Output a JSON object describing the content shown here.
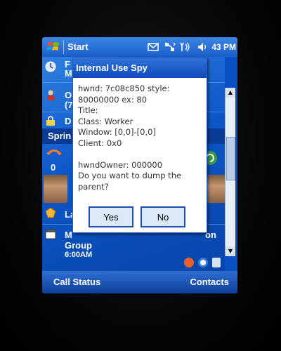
{
  "titlebar": {
    "app_label": "Start",
    "time": "43 PM",
    "icons": [
      "windows-flag-icon",
      "messaging-icon",
      "connectivity-icon",
      "signal-icon",
      "speaker-icon"
    ]
  },
  "today": {
    "partial_labels": {
      "date_row": "F\nM",
      "owner_row": "O\n(7",
      "lock_row": "D",
      "carrier_row": "Sprin",
      "missed_count": "0",
      "la_row": "La",
      "calendar_row_1": "M",
      "calendar_row_1_suffix": "on",
      "calendar_row_2": "Group",
      "calendar_time": "6:00AM"
    }
  },
  "dialog": {
    "title": "Internal Use Spy",
    "body": "hwnd: 7c08c850 style:\n80000000 ex: 80\nTitle:\nClass: Worker\nWindow: [0,0]-[0,0]\nClient: 0x0\n\nhwndOwner: 000000\nDo you want to dump the\nparent?",
    "yes_label": "Yes",
    "no_label": "No"
  },
  "softkeys": {
    "left": "Call Status",
    "right": "Contacts"
  },
  "colors": {
    "accent": "#1b5ec9",
    "today_background": "#0d56c8",
    "dialog_button": "#dbe9f8"
  }
}
